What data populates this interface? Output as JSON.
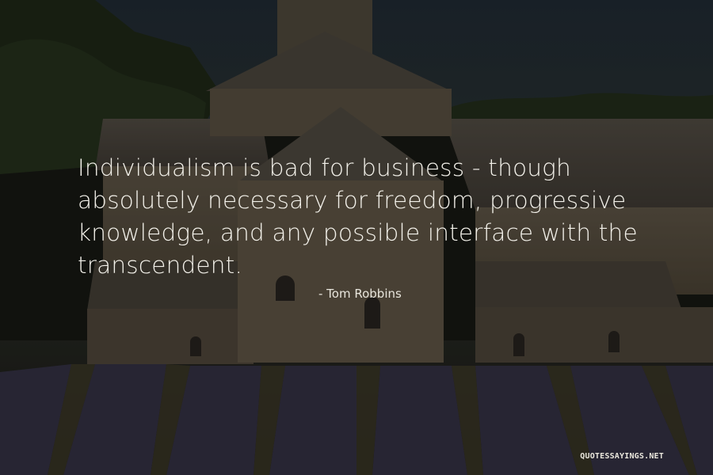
{
  "quote": {
    "text": "Individualism is bad for business - though absolutely necessary for freedom, progressive knowledge, and any possible interface with the transcendent.",
    "author": "- Tom Robbins"
  },
  "watermark": "QUOTESSAYINGS.NET",
  "colors": {
    "sky": "#232d36",
    "roof": "#5c544a",
    "wall": "#6d6150",
    "foliage": "#2a3420",
    "lavender": "#3f3b52",
    "text": "#f3f1ea"
  },
  "background": {
    "description_icon": "abbey-lavender-field-photo"
  }
}
